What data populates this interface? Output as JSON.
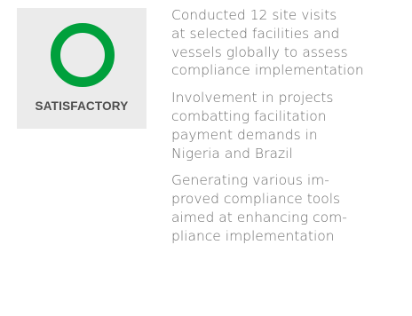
{
  "status": {
    "label": "SATISFACTORY",
    "color": "#00a03c",
    "icon": "ring-icon"
  },
  "items": [
    {
      "lines": [
        "Conducted 12 site visits",
        "at selected facilities and",
        "vessels globally to assess",
        "compliance implementation"
      ]
    },
    {
      "lines": [
        "Involvement in projects",
        "combatting facilitation",
        "payment demands in",
        "Nigeria and Brazil"
      ]
    },
    {
      "lines": [
        "Generating various im-",
        "proved compliance tools",
        "aimed at enhancing com-",
        "pliance implementation"
      ]
    }
  ]
}
